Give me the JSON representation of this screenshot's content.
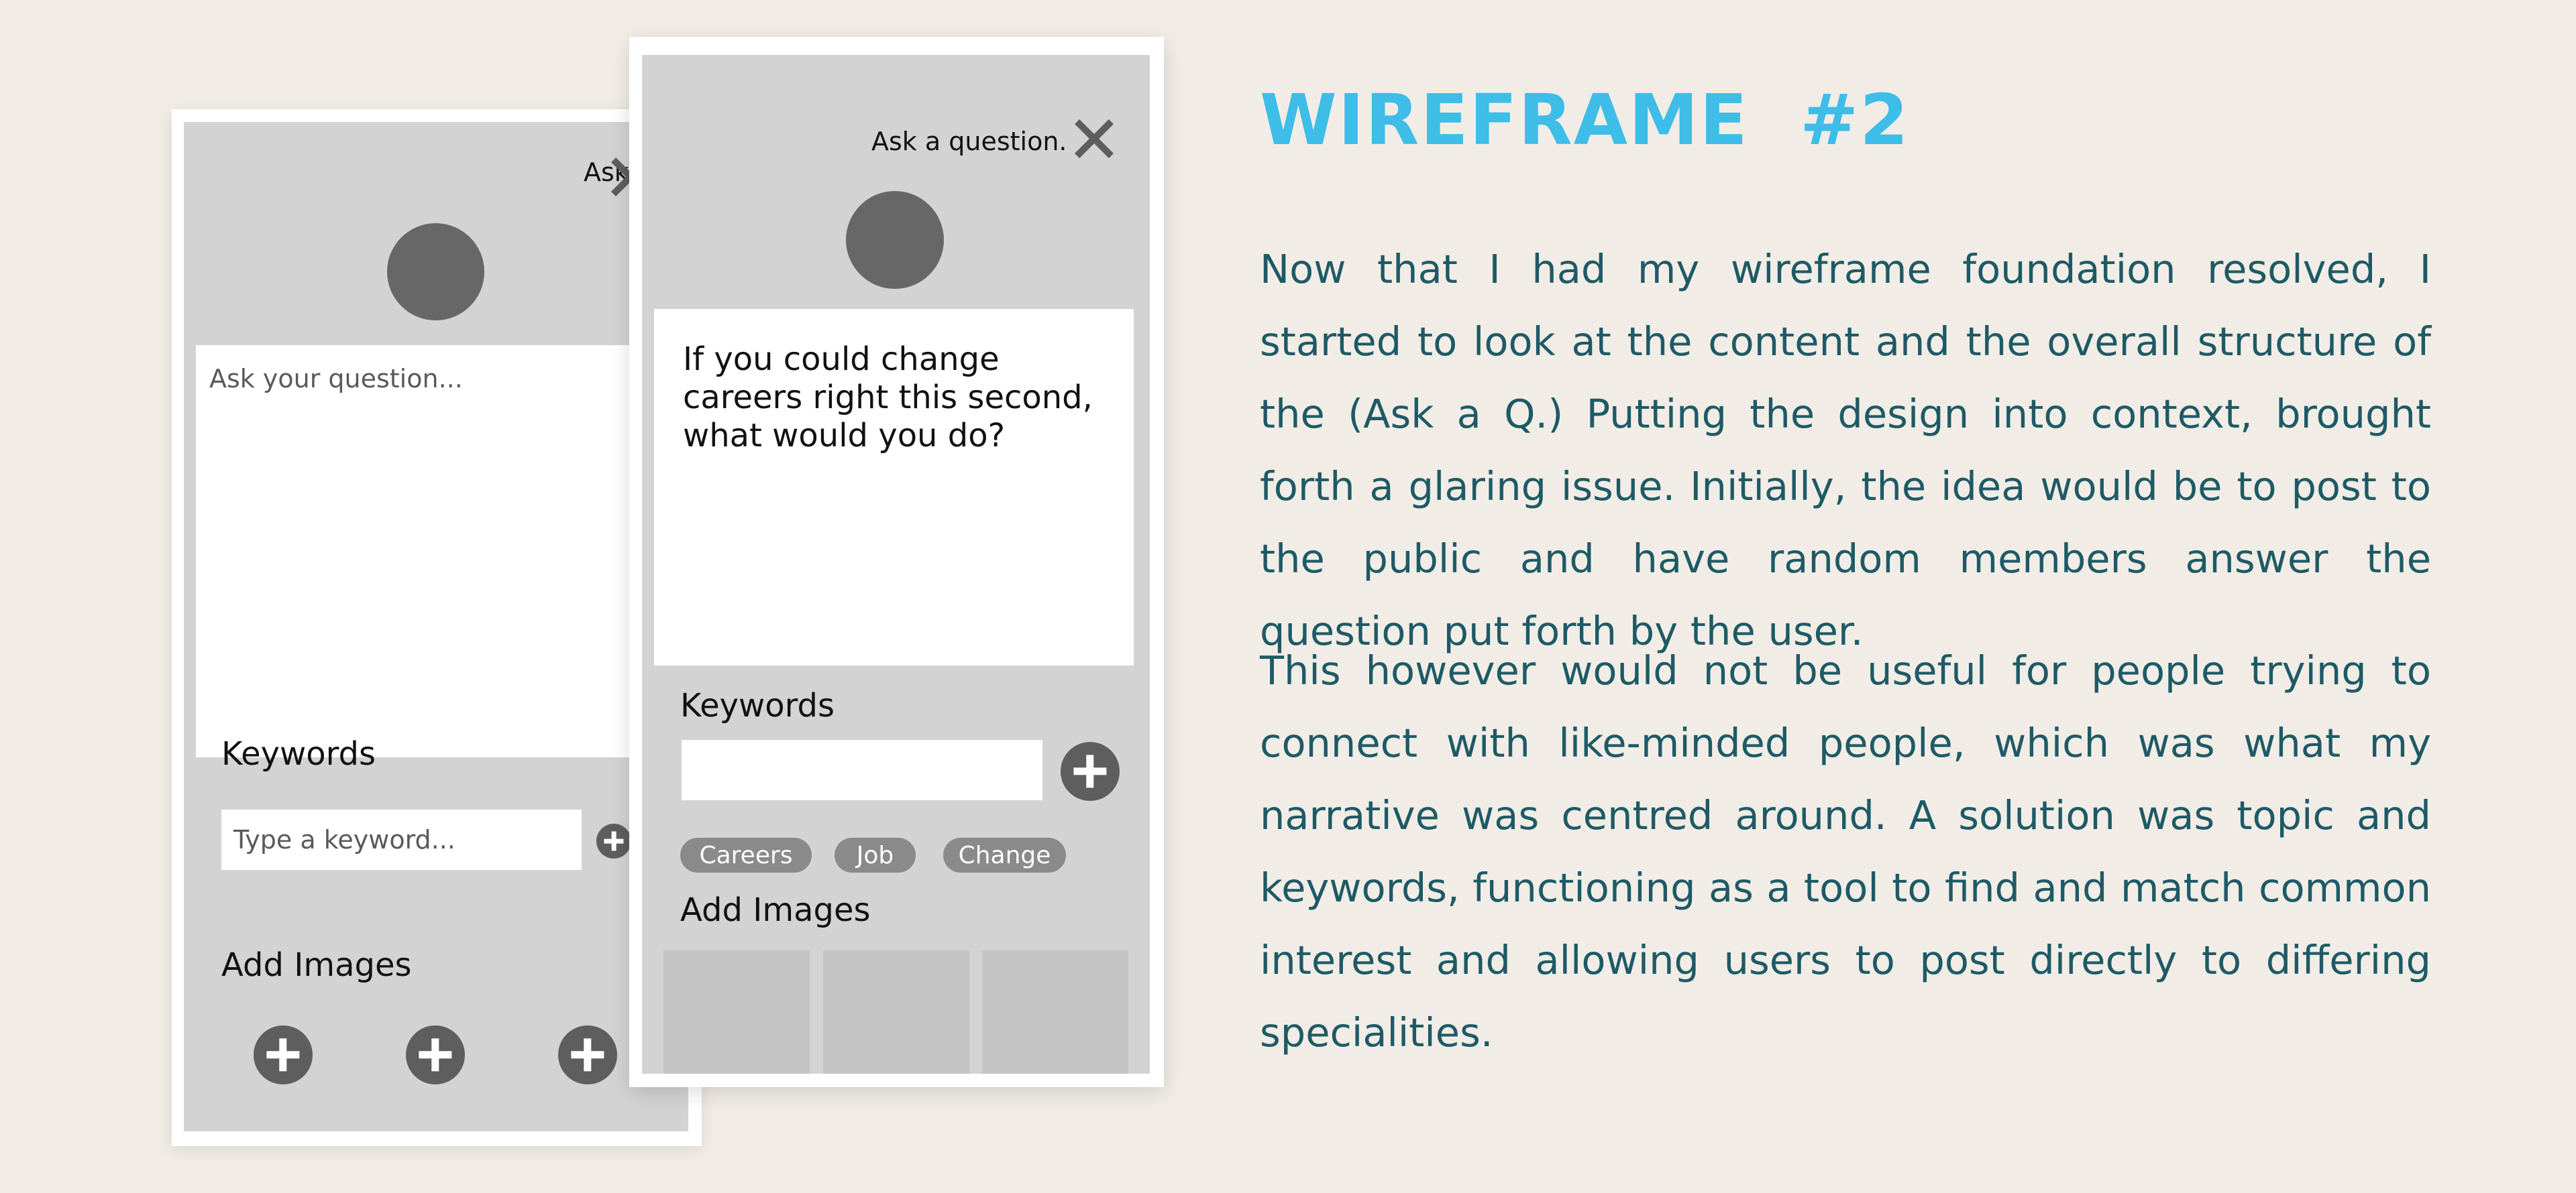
{
  "back_screen": {
    "header_title": "Ask a question.",
    "question_placeholder": "Ask your question...",
    "keywords_label": "Keywords",
    "keyword_placeholder": "Type a keyword...",
    "add_images_label": "Add Images"
  },
  "front_screen": {
    "header_title": "Ask a question.",
    "question_text": "If you could change careers right this second, what would you do?",
    "keywords_label": "Keywords",
    "keyword_chips": [
      "Careers",
      "Job",
      "Change"
    ],
    "add_images_label": "Add Images"
  },
  "article": {
    "heading": "WIREFRAME  #2",
    "paragraph_1": "Now that I had my wireframe foundation resolved, I started to look at the content and the overall structure of the (Ask a Q.) Putting the design into context, brought forth a glaring issue. Initially, the idea would be to post to the public and have random members answer the question put forth by the user.",
    "paragraph_2": "This however would not be useful for people trying to connect with like-minded people, which was what my narrative was centred around. A solution was topic and keywords, functioning as a tool to find and match common interest and allowing users to post directly to differing specialities."
  },
  "colors": {
    "background": "#f1ede6",
    "heading": "#3dbde8",
    "body_text": "#1e5a66",
    "screen_gray": "#d3d3d3",
    "icon_gray": "#5e5e5e",
    "chip_gray": "#8a8a8a"
  }
}
